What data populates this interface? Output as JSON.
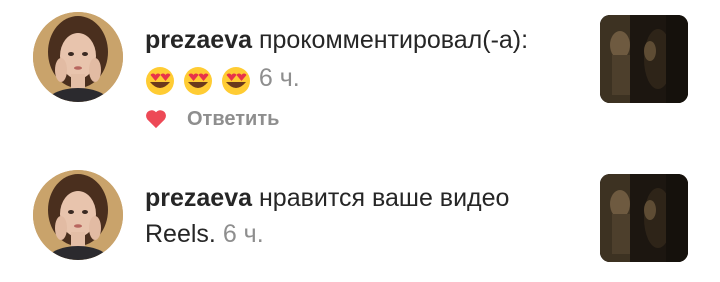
{
  "notifications": [
    {
      "username": "prezaeva",
      "action": "прокомментировал(-а):",
      "emojis": [
        "heart-eyes-emoji",
        "heart-eyes-emoji",
        "heart-eyes-emoji"
      ],
      "time": "6 ч.",
      "reply_label": "Ответить",
      "liked": true
    },
    {
      "username": "prezaeva",
      "action": "нравится ваше видео",
      "action_cont": "Reels.",
      "time": "6 ч."
    }
  ],
  "colors": {
    "text": "#262626",
    "secondary": "#8e8e8e",
    "heart": "#ed4956"
  }
}
